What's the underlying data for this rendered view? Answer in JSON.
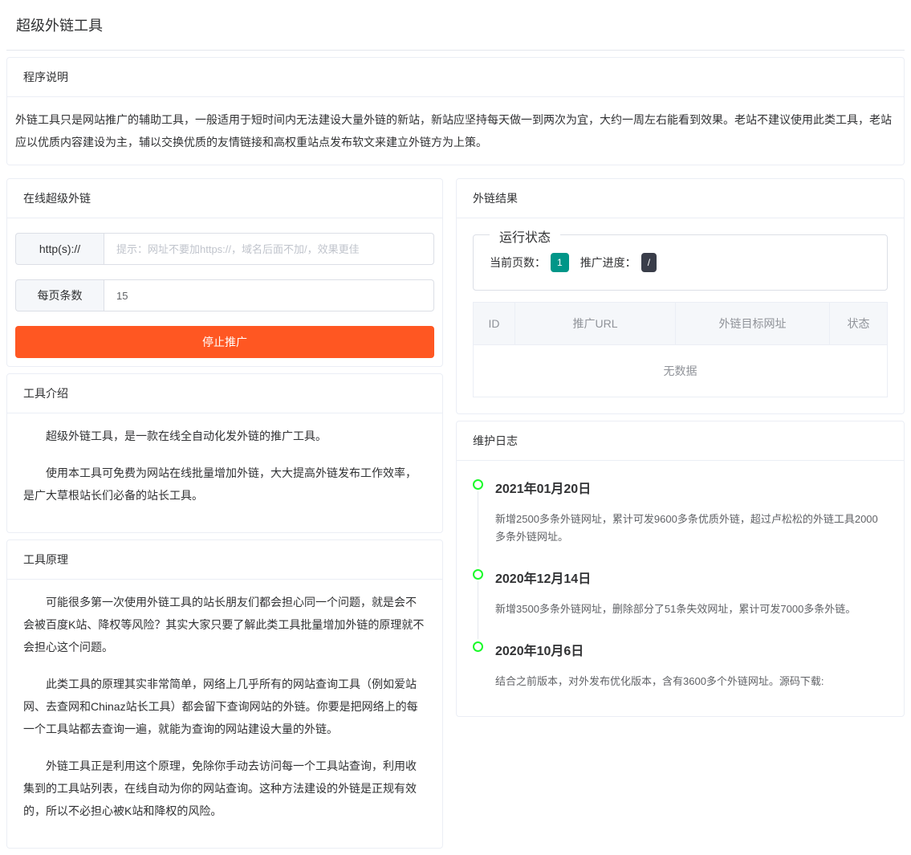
{
  "pageTitle": "超级外链工具",
  "description": {
    "header": "程序说明",
    "text": "外链工具只是网站推广的辅助工具，一般适用于短时间内无法建设大量外链的新站，新站应坚持每天做一到两次为宜，大约一周左右能看到效果。老站不建议使用此类工具，老站应以优质内容建设为主，辅以交换优质的友情链接和高权重站点发布软文来建立外链方为上策。"
  },
  "onlineTool": {
    "header": "在线超级外链",
    "urlPrefix": "http(s)://",
    "urlPlaceholder": "提示：网址不要加https://，域名后面不加/，效果更佳",
    "urlValue": "",
    "perPageLabel": "每页条数",
    "perPageValue": "15",
    "buttonLabel": "停止推广"
  },
  "result": {
    "header": "外链结果",
    "statusTitle": "运行状态",
    "currentPageLabel": "当前页数：",
    "currentPageValue": "1",
    "progressLabel": "推广进度：",
    "progressValue": "/",
    "columns": {
      "id": "ID",
      "url": "推广URL",
      "target": "外链目标网址",
      "status": "状态"
    },
    "emptyText": "无数据"
  },
  "intro": {
    "header": "工具介绍",
    "p1": "超级外链工具，是一款在线全自动化发外链的推广工具。",
    "p2": "使用本工具可免费为网站在线批量增加外链，大大提高外链发布工作效率，是广大草根站长们必备的站长工具。"
  },
  "principle": {
    "header": "工具原理",
    "p1": "可能很多第一次使用外链工具的站长朋友们都会担心同一个问题，就是会不会被百度K站、降权等风险？其实大家只要了解此类工具批量增加外链的原理就不会担心这个问题。",
    "p2": "此类工具的原理其实非常简单，网络上几乎所有的网站查询工具（例如爱站网、去查网和Chinaz站长工具）都会留下查询网站的外链。你要是把网络上的每一个工具站都去查询一遍，就能为查询的网站建设大量的外链。",
    "p3": "外链工具正是利用这个原理，免除你手动去访问每一个工具站查询，利用收集到的工具站列表，在线自动为你的网站查询。这种方法建设的外链是正规有效的，所以不必担心被K站和降权的风险。"
  },
  "changelog": {
    "header": "维护日志",
    "items": [
      {
        "date": "2021年01月20日",
        "content": "新增2500多条外链网址，累计可发9600多条优质外链，超过卢松松的外链工具2000多条外链网址。"
      },
      {
        "date": "2020年12月14日",
        "content": "新增3500多条外链网址，删除部分了51条失效网址，累计可发7000多条外链。"
      },
      {
        "date": "2020年10月6日",
        "content": "结合之前版本，对外发布优化版本，含有3600多个外链网址。源码下载:"
      }
    ]
  }
}
